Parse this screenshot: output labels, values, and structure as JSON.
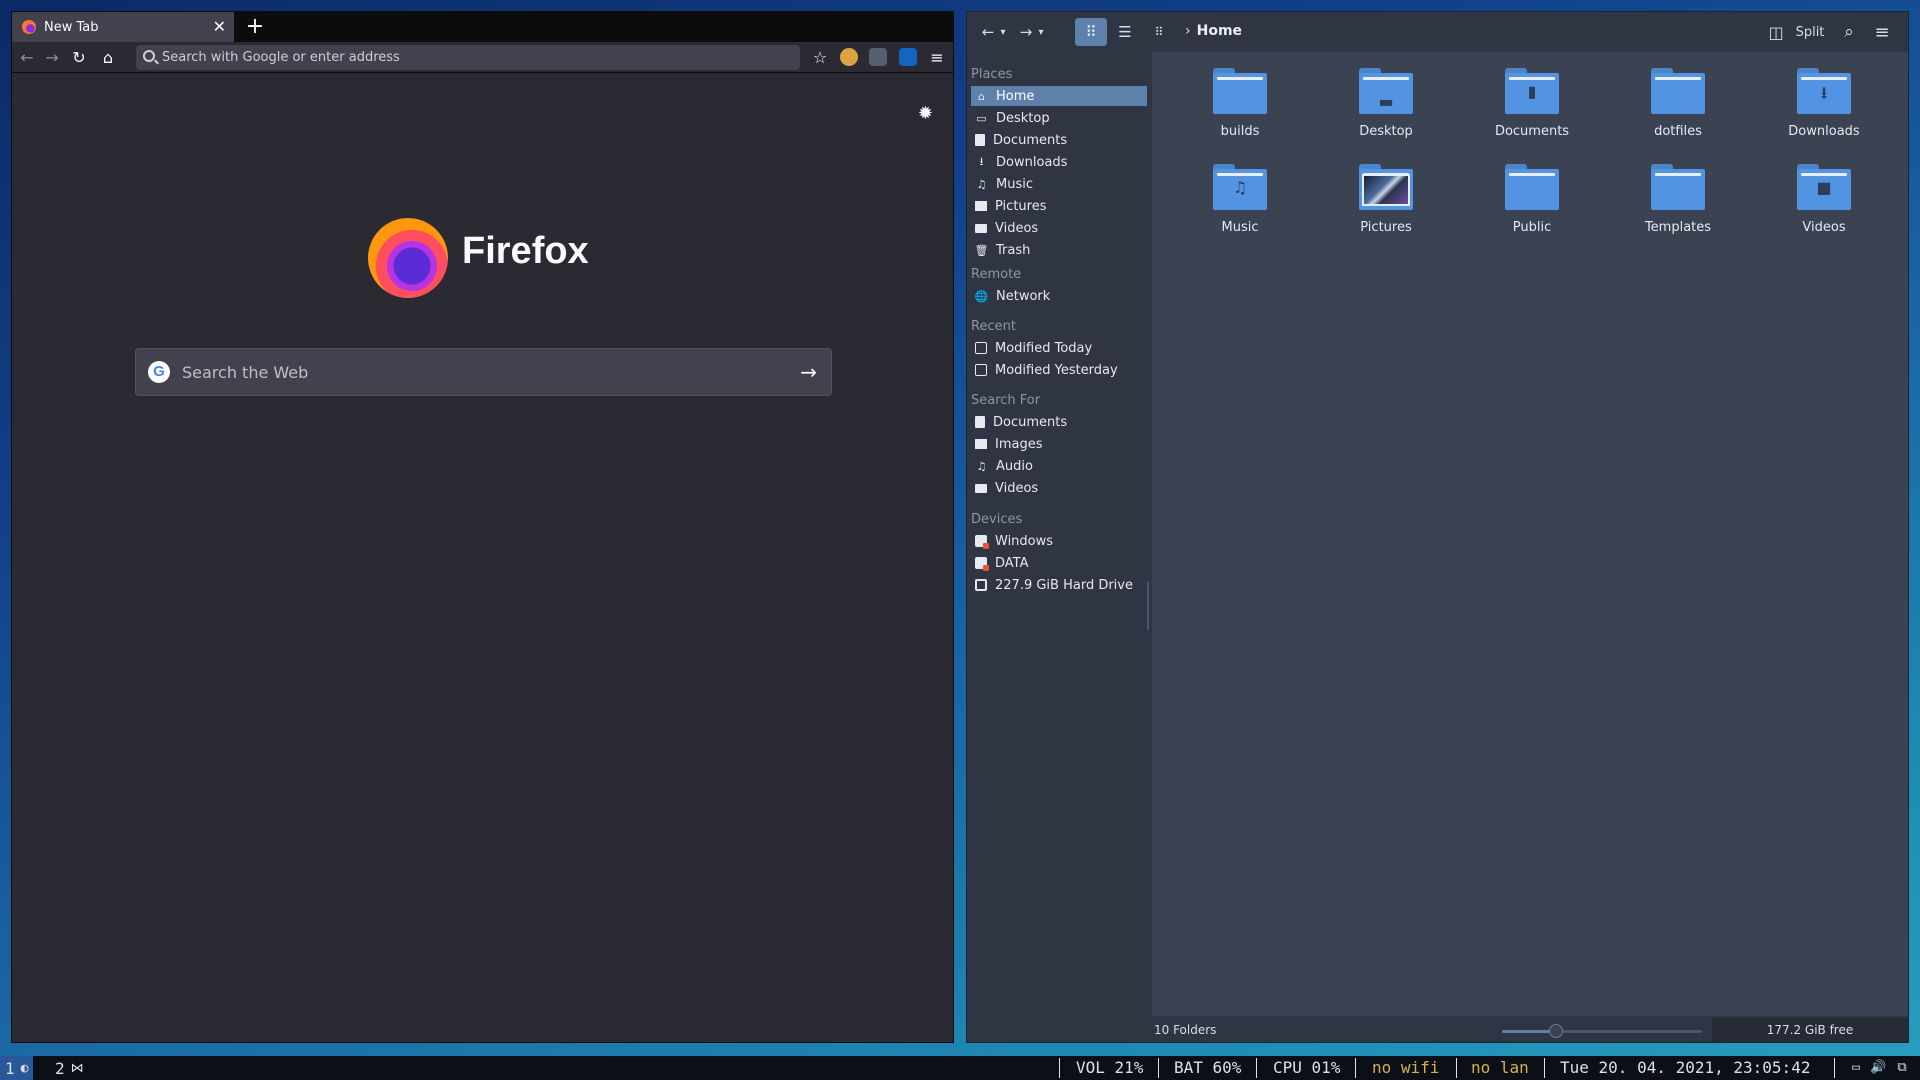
{
  "firefox": {
    "tab_title": "New Tab",
    "tab_close": "✕",
    "new_tab": "+",
    "url_placeholder": "Search with Google or enter address",
    "brand": "Firefox",
    "search_placeholder": "Search the Web",
    "search_g": "G",
    "search_arrow": "→",
    "settings_icon": "gear-icon",
    "icons": {
      "back": "←",
      "forward": "→",
      "reload": "↻",
      "home": "⌂",
      "bookmarks": "☆",
      "menu": "≡",
      "gear": "✹"
    },
    "extension_colors": [
      "#d9a441",
      "#55606e",
      "#1565c0"
    ]
  },
  "dolphin": {
    "breadcrumb": "Home",
    "breadcrumb_chevron": "›",
    "split_label": "Split",
    "icons": {
      "back": "←",
      "back_menu": "▾",
      "forward": "→",
      "forward_menu": "▾",
      "icons_view": "⠿",
      "details_view": "☰",
      "compact_view": "⠿",
      "split": "◫",
      "search": "⌕",
      "menu": "≡"
    },
    "sidebar": {
      "places_label": "Places",
      "places": [
        {
          "label": "Home",
          "icon": "⌂"
        },
        {
          "label": "Desktop",
          "icon": "▭"
        },
        {
          "label": "Documents",
          "icon": ""
        },
        {
          "label": "Downloads",
          "icon": "⭳"
        },
        {
          "label": "Music",
          "icon": "♫"
        },
        {
          "label": "Pictures",
          "icon": ""
        },
        {
          "label": "Videos",
          "icon": ""
        },
        {
          "label": "Trash",
          "icon": "🗑"
        }
      ],
      "remote_label": "Remote",
      "remote": [
        {
          "label": "Network",
          "icon": "🌐"
        }
      ],
      "recent_label": "Recent",
      "recent": [
        {
          "label": "Modified Today"
        },
        {
          "label": "Modified Yesterday"
        }
      ],
      "search_label": "Search For",
      "search": [
        {
          "label": "Documents",
          "icon": ""
        },
        {
          "label": "Images",
          "icon": ""
        },
        {
          "label": "Audio",
          "icon": "♫"
        },
        {
          "label": "Videos",
          "icon": ""
        }
      ],
      "devices_label": "Devices",
      "devices": [
        {
          "label": "Windows"
        },
        {
          "label": "DATA"
        },
        {
          "label": "227.9 GiB Hard Drive"
        }
      ]
    },
    "folders": [
      {
        "label": "builds",
        "glyph": ""
      },
      {
        "label": "Desktop",
        "glyph": "▬"
      },
      {
        "label": "Documents",
        "glyph": "▮"
      },
      {
        "label": "dotfiles",
        "glyph": ""
      },
      {
        "label": "Downloads",
        "glyph": "⭳"
      },
      {
        "label": "Music",
        "glyph": "♫"
      },
      {
        "label": "Pictures",
        "glyph": ""
      },
      {
        "label": "Public",
        "glyph": ""
      },
      {
        "label": "Templates",
        "glyph": ""
      },
      {
        "label": "Videos",
        "glyph": "■"
      }
    ],
    "status": {
      "count": "10 Folders",
      "free": "177.2 GiB free",
      "zoom_level": 0.27
    }
  },
  "statusbar": {
    "ws1": "1",
    "ws1_icon": "◐",
    "ws2": "2",
    "ws2_icon": "⋈",
    "vol": "VOL 21%",
    "bat": "BAT 60%",
    "cpu": "CPU 01%",
    "wifi": "no wifi",
    "lan": "no lan",
    "datetime": "Tue 20. 04. 2021, 23:05:42",
    "tray_icons": [
      "▭",
      "🔊",
      "⧉"
    ]
  },
  "colors": {
    "accent": "#5e81ac",
    "firefox_bg": "#2b2a33",
    "dolphin_view": "#3b4252",
    "folder_blue": "#5294e2",
    "warning": "#d4b24a"
  }
}
